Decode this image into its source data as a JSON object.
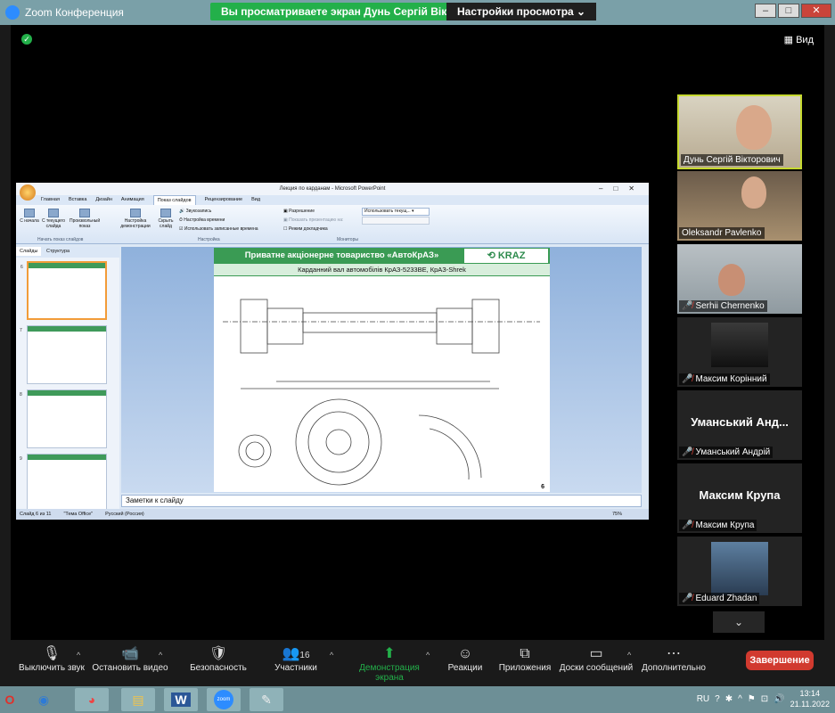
{
  "window": {
    "app_title": "Zoom Конференция",
    "share_banner": "Вы просматриваете экран Дунь Сергій Вікторович",
    "view_settings": "Настройки просмотра",
    "view_button": "Вид"
  },
  "ppt": {
    "window_title": "Лекция по карданам - Microsoft PowerPoint",
    "tabs": [
      "Главная",
      "Вставка",
      "Дизайн",
      "Анимация",
      "Показ слайдов",
      "Рецензирование",
      "Вид"
    ],
    "active_tab": "Показ слайдов",
    "ribbon": {
      "from_start": "С начала",
      "from_current": "С текущего слайда",
      "custom_show": "Произвольный показ",
      "group_start": "Начать показ слайдов",
      "setup_show": "Настройка демонстрации",
      "hide_slide": "Скрыть слайд",
      "record_narration": "Звукозапись",
      "rehearse_timings": "Настройка времени",
      "use_timings": "Использовать записанные времена",
      "group_setup": "Настройка",
      "resolution": "Разрешение",
      "resolution_value": "Использовать текущ...",
      "show_on": "Показать презентацию на:",
      "presenter_view": "Режим докладчика",
      "group_monitors": "Мониторы"
    },
    "panel_tabs": [
      "Слайды",
      "Структура"
    ],
    "thumb_numbers": [
      "6",
      "7",
      "8",
      "9"
    ],
    "slide": {
      "title": "Приватне акціонерне товариство «АвтоКрАЗ»",
      "logo": "KRAZ",
      "subtitle": "Карданний вал автомобілів КрАЗ-5233ВЕ, КрАЗ-Shrek",
      "page": "6"
    },
    "notes": "Заметки к слайду",
    "status": {
      "slide": "Слайд 6 из 11",
      "theme": "\"Тема Office\"",
      "language": "Русский (Россия)",
      "zoom": "75%"
    }
  },
  "participants": [
    {
      "name": "Дунь Сергій Вікторович",
      "muted": false,
      "video": true
    },
    {
      "name": "Oleksandr Pavlenko",
      "muted": false,
      "video": true
    },
    {
      "name": "Serhii Chernenko",
      "muted": true,
      "video": true
    },
    {
      "name": "Максим Корінний",
      "muted": true,
      "video": true
    },
    {
      "name": "Уманський Андрій",
      "display": "Уманський  Анд...",
      "muted": true,
      "video": false
    },
    {
      "name": "Максим Крупа",
      "display": "Максим Крупа",
      "muted": true,
      "video": false
    },
    {
      "name": "Eduard Zhadan",
      "muted": true,
      "video": true
    }
  ],
  "toolbar": {
    "mute": "Выключить звук",
    "video": "Остановить видео",
    "security": "Безопасность",
    "participants": "Участники",
    "participants_count": "16",
    "share": "Демонстрация экрана",
    "reactions": "Реакции",
    "apps": "Приложения",
    "whiteboards": "Доски сообщений",
    "more": "Дополнительно",
    "end": "Завершение"
  },
  "taskbar": {
    "lang": "RU",
    "time": "13:14",
    "date": "21.11.2022"
  },
  "colors": {
    "zoom_green": "#23b04a",
    "end_red": "#d13a2f",
    "active_speaker": "#c6d92f",
    "kraz_green": "#3a9b54"
  }
}
